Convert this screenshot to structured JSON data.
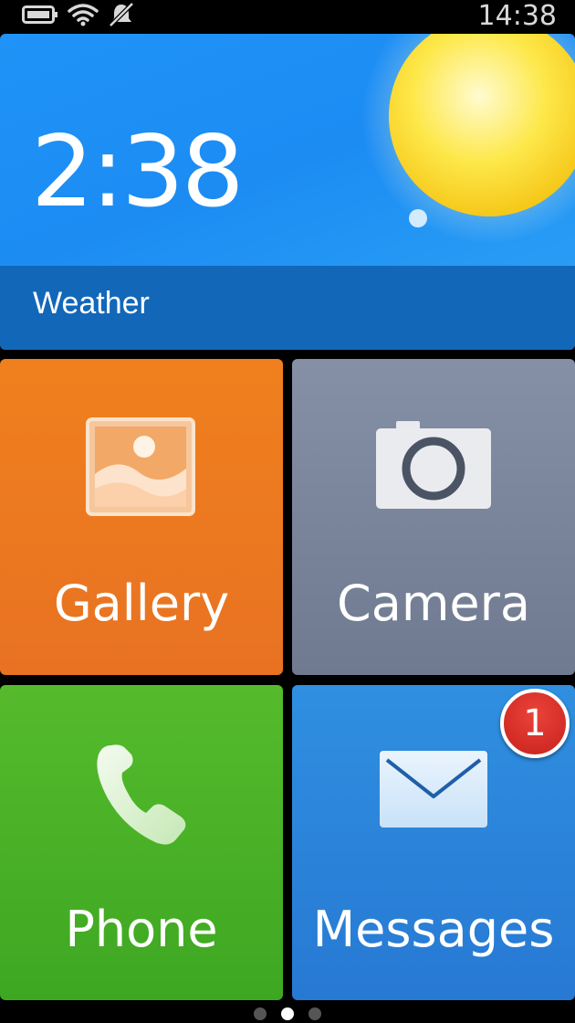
{
  "status_bar": {
    "time": "14:38",
    "icons": [
      "battery-icon",
      "wifi-icon",
      "mute-icon"
    ]
  },
  "tiles": {
    "weather": {
      "time": "2:38",
      "label": "Weather",
      "icon": "sun-icon"
    },
    "gallery": {
      "label": "Gallery",
      "icon": "picture-icon",
      "color": "#ed7b20"
    },
    "camera": {
      "label": "Camera",
      "icon": "camera-icon",
      "color": "#7b859b"
    },
    "phone": {
      "label": "Phone",
      "icon": "phone-handset-icon",
      "color": "#4cb327"
    },
    "messages": {
      "label": "Messages",
      "icon": "envelope-icon",
      "color": "#2b85da",
      "badge": "1"
    }
  },
  "pager": {
    "pages": 3,
    "current": 2
  }
}
